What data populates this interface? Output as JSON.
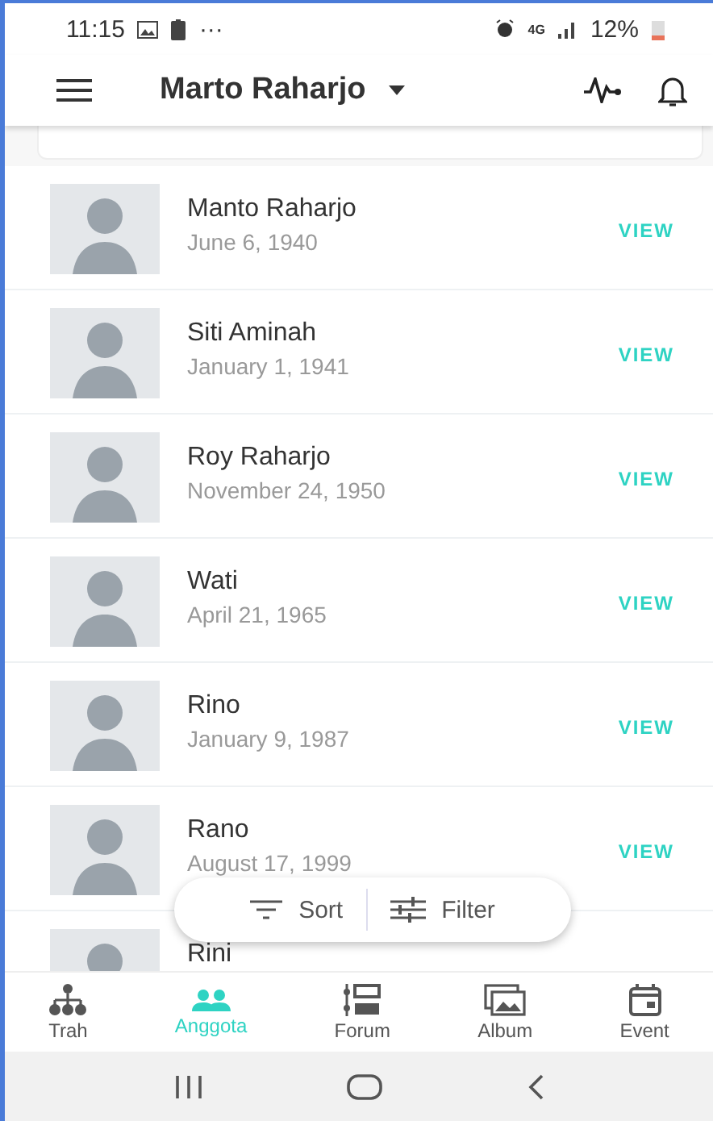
{
  "status_bar": {
    "time": "11:15",
    "overflow": "···",
    "network": "4G",
    "battery": "12%"
  },
  "app_bar": {
    "title": "Marto Raharjo"
  },
  "members": [
    {
      "name": "Manto Raharjo",
      "date": "June 6, 1940",
      "action": "VIEW"
    },
    {
      "name": "Siti Aminah",
      "date": "January 1, 1941",
      "action": "VIEW"
    },
    {
      "name": "Roy Raharjo",
      "date": "November 24, 1950",
      "action": "VIEW"
    },
    {
      "name": "Wati",
      "date": "April 21, 1965",
      "action": "VIEW"
    },
    {
      "name": "Rino",
      "date": "January 9, 1987",
      "action": "VIEW"
    },
    {
      "name": "Rano",
      "date": "August 17, 1999",
      "action": "VIEW"
    },
    {
      "name": "Rini"
    }
  ],
  "sort_filter": {
    "sort": "Sort",
    "filter": "Filter"
  },
  "bottom_nav": [
    {
      "label": "Trah",
      "selected": false,
      "kind": "tree"
    },
    {
      "label": "Anggota",
      "selected": true,
      "kind": "people"
    },
    {
      "label": "Forum",
      "selected": false,
      "kind": "forum"
    },
    {
      "label": "Album",
      "selected": false,
      "kind": "album"
    },
    {
      "label": "Event",
      "selected": false,
      "kind": "event"
    }
  ]
}
